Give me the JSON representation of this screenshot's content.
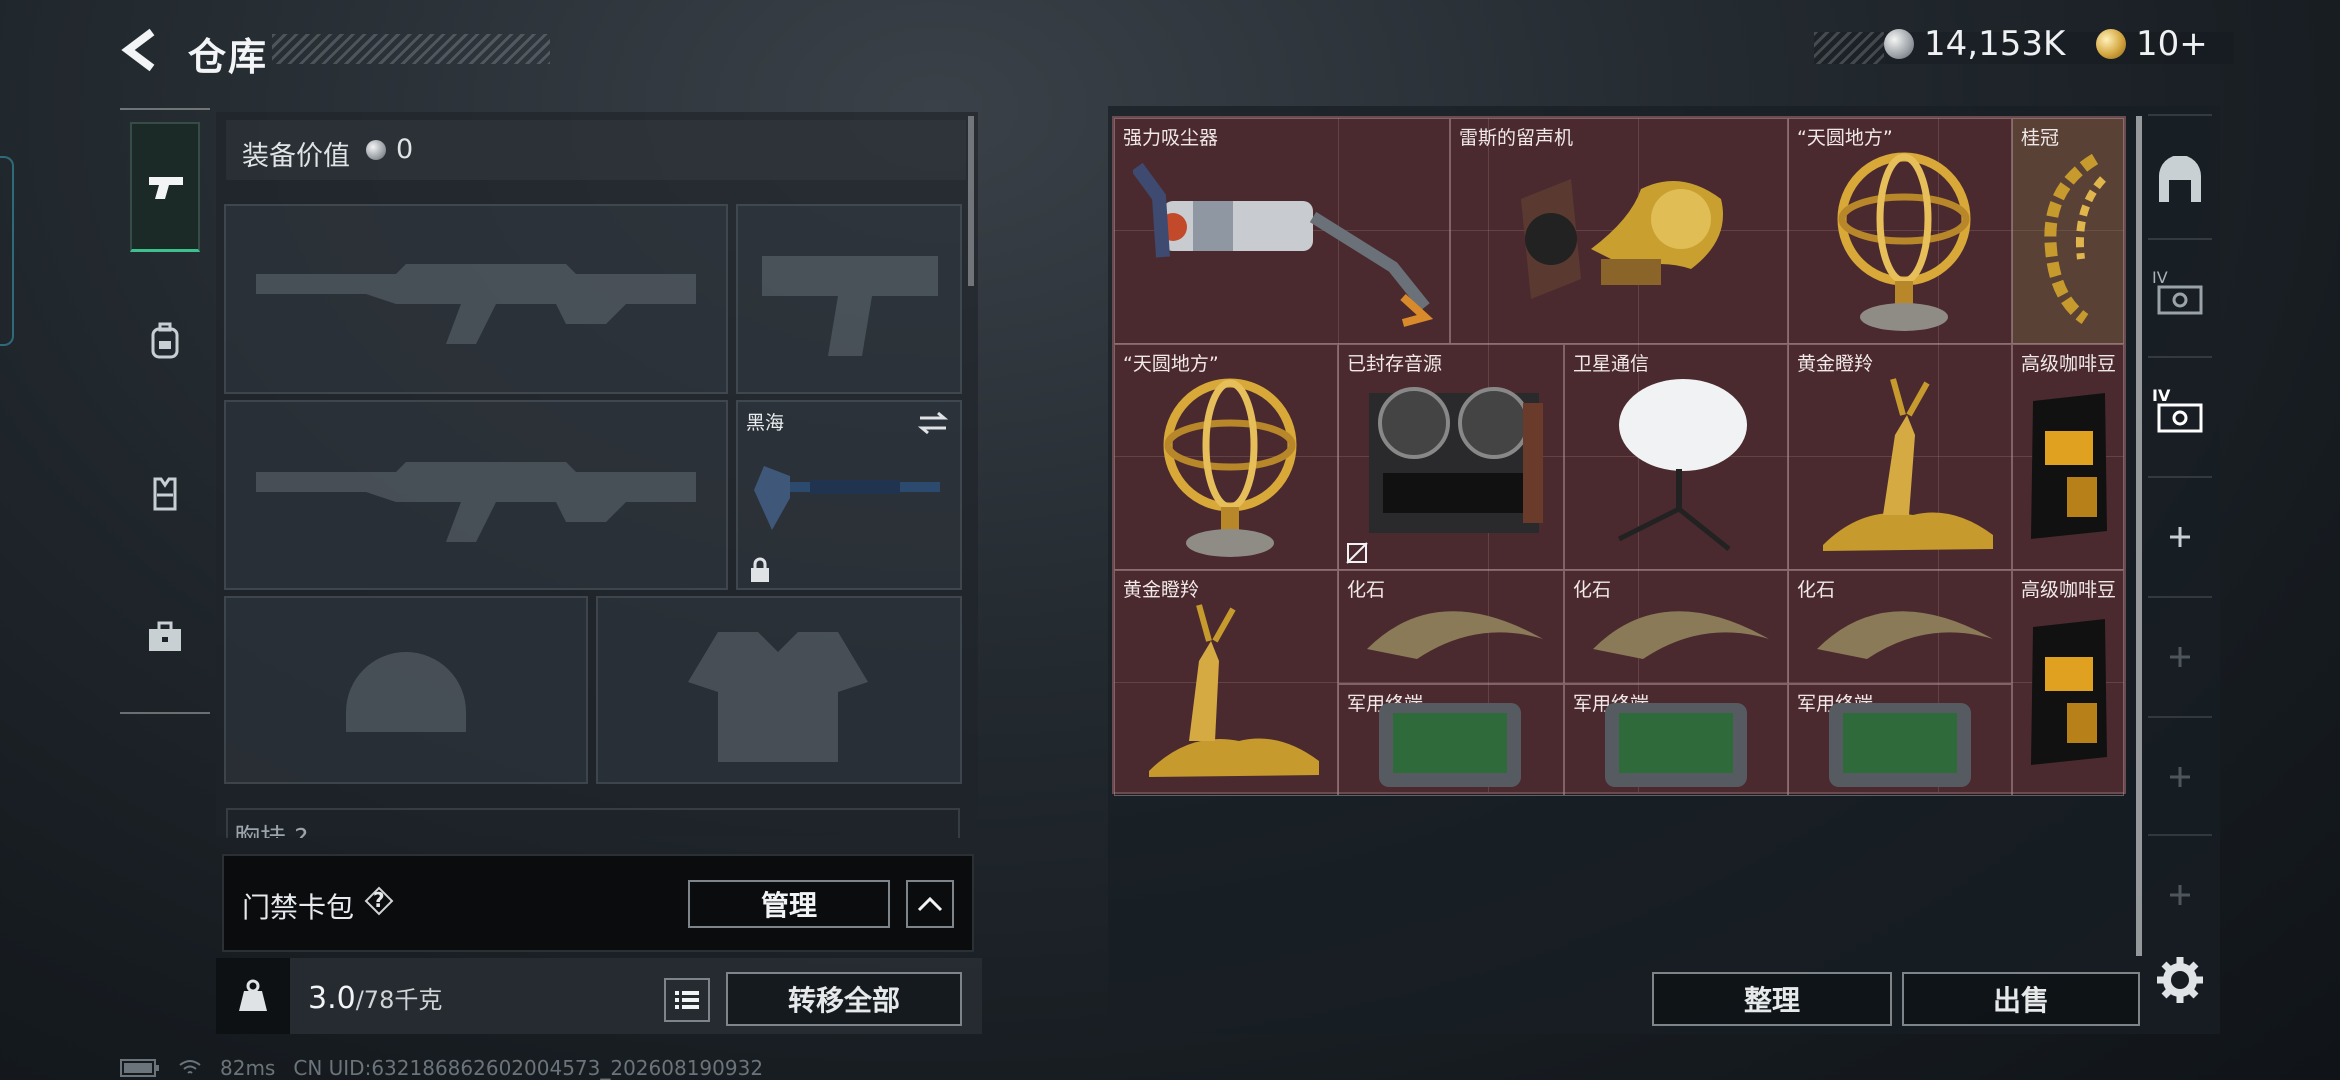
{
  "header": {
    "title": "仓库",
    "money": "14,153K",
    "tickets": "10+"
  },
  "equipment": {
    "value_label": "装备价值",
    "value": "0",
    "melee_name": "黑海",
    "chest_label": "胸挂 ?"
  },
  "keycard": {
    "label": "门禁卡包",
    "help": "?",
    "manage_button": "管理"
  },
  "capacity": {
    "current": "3.0",
    "max": "/78千克",
    "transfer_button": "转移全部"
  },
  "storage": {
    "items": [
      {
        "name": "强力吸尘器",
        "icon": "vacuum-icon"
      },
      {
        "name": "雷斯的留声机",
        "icon": "gramophone-icon"
      },
      {
        "name": "“天圆地方”",
        "icon": "armillary-sphere-icon"
      },
      {
        "name": "桂冠",
        "icon": "laurel-crown-icon"
      },
      {
        "name": "“天圆地方”",
        "icon": "armillary-sphere-icon"
      },
      {
        "name": "已封存音源",
        "icon": "reel-tape-recorder-icon"
      },
      {
        "name": "卫星通信",
        "icon": "satellite-dish-icon"
      },
      {
        "name": "黄金瞪羚",
        "icon": "golden-gazelle-icon"
      },
      {
        "name": "高级咖啡豆",
        "icon": "coffee-bag-icon"
      },
      {
        "name": "黄金瞪羚",
        "icon": "golden-gazelle-icon"
      },
      {
        "name": "化石",
        "icon": "fossil-claw-icon"
      },
      {
        "name": "化石",
        "icon": "fossil-claw-icon"
      },
      {
        "name": "化石",
        "icon": "fossil-claw-icon"
      },
      {
        "name": "高级咖啡豆",
        "icon": "coffee-bag-icon"
      },
      {
        "name": "军用终端",
        "icon": "military-terminal-icon"
      },
      {
        "name": "军用终端",
        "icon": "military-terminal-icon"
      },
      {
        "name": "军用终端",
        "icon": "military-terminal-icon"
      }
    ],
    "sort_button": "整理",
    "sell_button": "出售"
  },
  "side_tabs": [
    "IV",
    "IV"
  ],
  "status": {
    "ping": "82ms",
    "uid": "CN UID:6321868626020045​73_202608190932"
  }
}
